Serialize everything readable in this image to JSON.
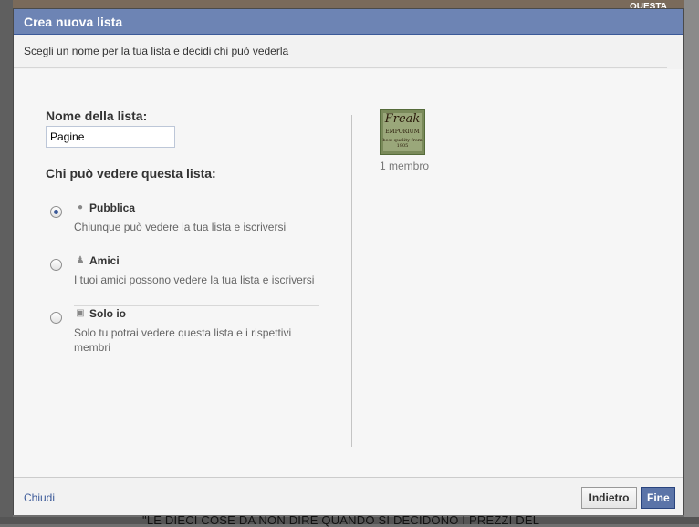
{
  "dialog": {
    "title": "Crea nuova lista",
    "subtitle": "Scegli un nome per la tua lista e decidi chi può vederla"
  },
  "form": {
    "name_label": "Nome della lista:",
    "name_value": "Pagine",
    "visibility_label": "Chi può vedere questa lista:",
    "options": [
      {
        "title": "Pubblica",
        "description": "Chiunque può vedere la tua lista e iscriversi",
        "icon": "globe-icon",
        "selected": true
      },
      {
        "title": "Amici",
        "description": "I tuoi amici possono vedere la tua lista e iscriversi",
        "icon": "friends-icon",
        "selected": false
      },
      {
        "title": "Solo io",
        "description": "Solo tu potrai vedere questa lista e i rispettivi membri",
        "icon": "lock-icon",
        "selected": false
      }
    ]
  },
  "preview": {
    "thumbnail_text": [
      "Freak",
      "EMPORIUM",
      "best quality from 1905"
    ],
    "member_count": "1 membro"
  },
  "footer": {
    "close_label": "Chiudi",
    "back_label": "Indietro",
    "done_label": "Fine"
  },
  "background": {
    "bottom_text": "\"LE DIECI COSE DA NON DIRE QUANDO SI DECIDONO I PREZZI DEL",
    "top_right_text": "QUESTA"
  },
  "colors": {
    "titlebar": "#6d84b4",
    "link": "#3b5998",
    "primary_button": "#5b74a8"
  }
}
